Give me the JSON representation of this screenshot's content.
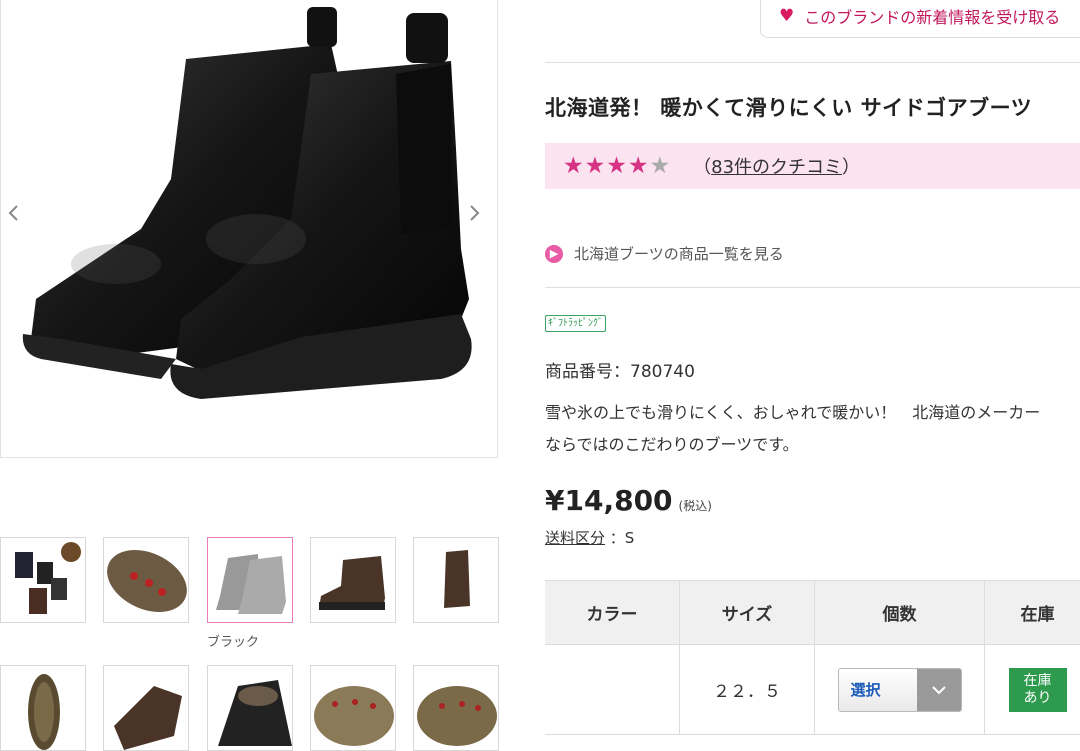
{
  "brand_follow": {
    "label": "このブランドの新着情報を受け取る",
    "icon": "heart-icon",
    "color": "#d81b60"
  },
  "product": {
    "title": "北海道発！ 暖かくて滑りにくい サイドゴアブーツ",
    "rating": {
      "value": 4,
      "max": 5,
      "reviews_link": "83件のクチコミ",
      "open": "（",
      "close": "）"
    },
    "category_link": "北海道ブーツの商品一覧を見る",
    "gift_badge": "ｷﾞﾌﾄﾗｯﾋﾟﾝｸﾞ",
    "code": "商品番号：780740",
    "description": [
      "雪や氷の上でも滑りにくく、おしゃれで暖かい！　北海道のメーカー",
      "ならではのこだわりのブーツです。"
    ],
    "price": "¥14,800",
    "tax_note": "(税込)",
    "shipping_label": "送料区分",
    "shipping_value": "：S"
  },
  "gallery": {
    "selected_caption": "ブラック",
    "thumbnails": [
      "colors",
      "sole-spikes",
      "black",
      "brown",
      "brown-side",
      "sole",
      "brown-top",
      "lining",
      "sole-studs-1",
      "sole-studs-2"
    ]
  },
  "table": {
    "headers": [
      "カラー",
      "サイズ",
      "個数",
      "在庫"
    ],
    "rows": [
      {
        "color": "",
        "size": "２２．５",
        "select_label": "選択",
        "stock": "在庫あり"
      }
    ]
  },
  "colors": {
    "accent_pink": "#d63384",
    "rating_bg": "#fbe3f0",
    "stock_green": "#2e9a4e"
  }
}
